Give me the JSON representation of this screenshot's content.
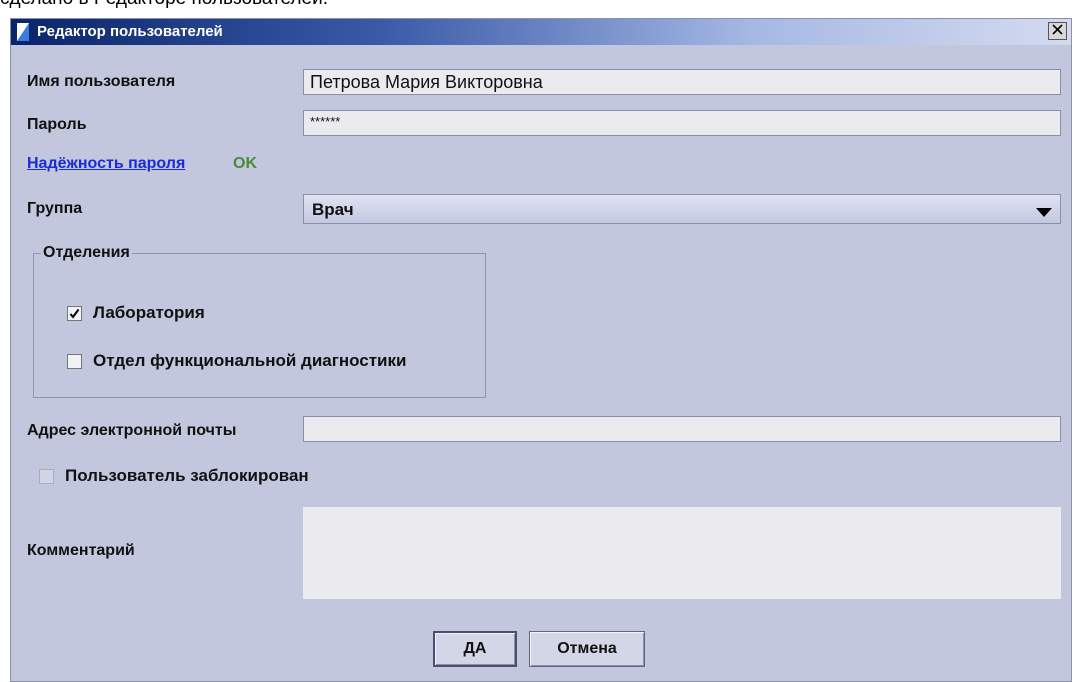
{
  "caption": "сделано в Редакторе пользователей.",
  "window": {
    "title": "Редактор пользователей"
  },
  "form": {
    "username_label": "Имя пользователя",
    "username_value": "Петрова Мария Викторовна",
    "password_label": "Пароль",
    "password_value": "******",
    "strength_link": "Надёжность пароля",
    "strength_value": "OK",
    "group_label": "Группа",
    "group_value": "Врач",
    "departments_legend": "Отделения",
    "departments": [
      {
        "label": "Лаборатория",
        "checked": true
      },
      {
        "label": "Отдел функциональной диагностики",
        "checked": false
      }
    ],
    "email_label": "Адрес электронной почты",
    "email_value": "",
    "blocked_label": "Пользователь заблокирован",
    "blocked_checked": false,
    "comment_label": "Комментарий",
    "comment_value": ""
  },
  "buttons": {
    "ok": "ДА",
    "cancel": "Отмена"
  },
  "colors": {
    "dialog_bg": "#c3c7dd",
    "title_gradient_start": "#0a246a",
    "link": "#1a2bd8",
    "ok_status": "#4a8a3a"
  },
  "icons": {
    "title": "window-app-icon",
    "close": "close-x-icon",
    "dropdown": "triangle-down-icon",
    "check": "checkmark-icon"
  }
}
